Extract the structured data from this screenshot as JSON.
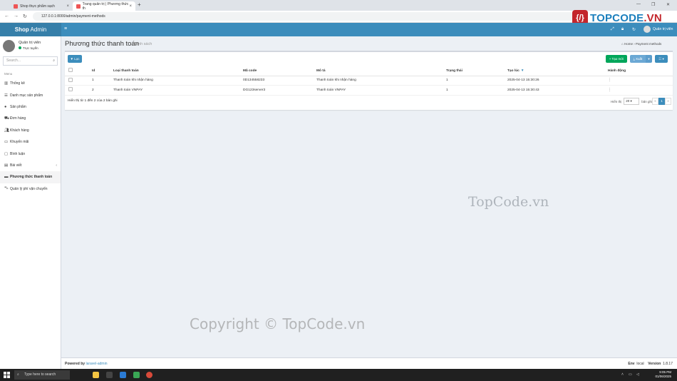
{
  "browser": {
    "tabs": [
      {
        "title": "Shop thực phẩm sạch"
      },
      {
        "title": "Trang quản trị | Phương thức th"
      }
    ],
    "url": "127.0.0.1:8000/admin/payment-methods"
  },
  "watermarks": {
    "logo_left": "TOPCODE",
    "logo_right": ".VN",
    "center": "TopCode.vn",
    "copyright": "Copyright © TopCode.vn"
  },
  "header": {
    "brand_bold": "Shop",
    "brand_rest": " Admin",
    "user": "Quản trị viên"
  },
  "sidebar": {
    "user_name": "Quản trị viên",
    "user_status": "Trực tuyến",
    "search_placeholder": "Search...",
    "menu_header": "Menu",
    "items": [
      {
        "label": "Thống kê",
        "icon": "bar-chart-icon"
      },
      {
        "label": "Danh mục sản phẩm",
        "icon": "list-icon"
      },
      {
        "label": "Sản phẩm",
        "icon": "circle-icon"
      },
      {
        "label": "Đơn hàng",
        "icon": "truck-icon"
      },
      {
        "label": "Khách hàng",
        "icon": "users-icon"
      },
      {
        "label": "Khuyến mãi",
        "icon": "percent-icon"
      },
      {
        "label": "Bình luận",
        "icon": "comment-icon"
      },
      {
        "label": "Bài viết",
        "icon": "file-icon"
      },
      {
        "label": "Phương thức thanh toán",
        "icon": "credit-card-icon"
      },
      {
        "label": "Quản lý phí vận chuyển",
        "icon": "car-icon"
      }
    ]
  },
  "page": {
    "title": "Phương thức thanh toán",
    "subtitle": "Danh sách",
    "breadcrumb_home": "Home",
    "breadcrumb_current": "Payment methods"
  },
  "toolbar": {
    "filter": "Lọc",
    "create": "Tạo mới",
    "export": "Xuất"
  },
  "table": {
    "columns": [
      "Id",
      "Loại thanh toán",
      "Mã code",
      "Mô tả",
      "Trạng thái",
      "Tạo lúc",
      "Hành động"
    ],
    "rows": [
      {
        "id": "1",
        "type": "Thanh toán khi nhận hàng",
        "code": "0D134558233",
        "desc": "Thanh toán khi nhận hàng",
        "status": "1",
        "created": "2025-04-13 15:30:26",
        "action": "⋮"
      },
      {
        "id": "2",
        "type": "Thanh toán VNPAY",
        "code": "DG123server3",
        "desc": "Thanh toán VNPAY",
        "status": "1",
        "created": "2025-04-13 15:30:43",
        "action": "⋮"
      }
    ],
    "summary": "Hiển thị từ 1 đến 2 của 2 bản ghi",
    "per_page_label": "Hiển thị",
    "per_page_value": "20",
    "per_page_suffix": "bản ghi",
    "pager": [
      "«",
      "1",
      "»"
    ]
  },
  "footer": {
    "powered_by": "Powered by",
    "powered_link": "laravel-admin",
    "env_label": "Env",
    "env_value": "local",
    "version_label": "Version",
    "version_value": "1.8.17"
  },
  "taskbar": {
    "search": "Type here to search",
    "time": "9:05 PM",
    "date": "01/06/2025"
  }
}
